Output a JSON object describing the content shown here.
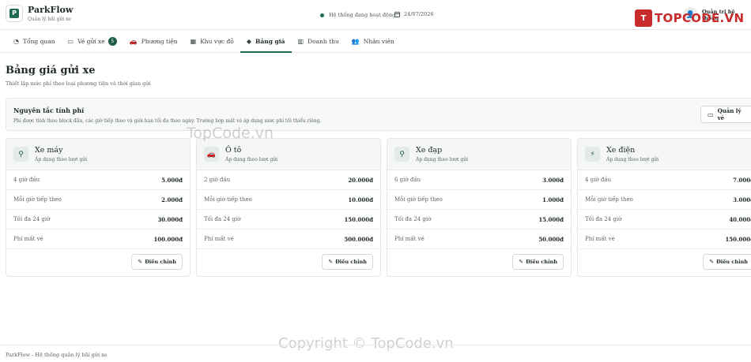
{
  "header": {
    "app_name": "ParkFlow",
    "app_tagline": "Quản lý bãi gửi xe",
    "logo_letter": "P",
    "status_text": "Hệ thống đang hoạt động",
    "date": "24/07/2026",
    "admin_label": "Quản trị hệ thống",
    "status_color": "#1f6b4f"
  },
  "watermark": {
    "logo_letter": "T",
    "logo_text": "TOPCODE.VN",
    "mid_text": "TopCode.vn",
    "bottom_text": "Copyright © TopCode.vn"
  },
  "nav": {
    "items": [
      {
        "label": "Tổng quan",
        "icon": "gauge-icon"
      },
      {
        "label": "Vé gửi xe",
        "icon": "ticket-icon",
        "badge": "5"
      },
      {
        "label": "Phương tiện",
        "icon": "car-icon"
      },
      {
        "label": "Khu vực đỗ",
        "icon": "map-icon"
      },
      {
        "label": "Bảng giá",
        "icon": "tag-icon",
        "active": true
      },
      {
        "label": "Doanh thu",
        "icon": "chart-icon"
      },
      {
        "label": "Nhân viên",
        "icon": "users-icon"
      }
    ]
  },
  "page": {
    "title": "Bảng giá gửi xe",
    "subtitle": "Thiết lập mức phí theo loại phương tiện và thời gian gửi"
  },
  "rules": {
    "title": "Nguyên tắc tính phí",
    "text": "Phí được tính theo block đầu, các giờ tiếp theo và giới hạn tối đa theo ngày. Trường hợp mất vé áp dụng mức phí tối thiểu riêng.",
    "button_label": "Quản lý vé"
  },
  "cards": [
    {
      "name": "Xe máy",
      "desc": "Áp dụng theo lượt gửi",
      "icon": "motorbike-icon",
      "rows": [
        {
          "label": "4 giờ đầu",
          "value": "5.000đ"
        },
        {
          "label": "Mỗi giờ tiếp theo",
          "value": "2.000đ"
        },
        {
          "label": "Tối đa 24 giờ",
          "value": "30.000đ"
        },
        {
          "label": "Phí mất vé",
          "value": "100.000đ"
        }
      ],
      "edit_label": "Điều chỉnh"
    },
    {
      "name": "Ô tô",
      "desc": "Áp dụng theo lượt gửi",
      "icon": "car-icon",
      "rows": [
        {
          "label": "2 giờ đầu",
          "value": "20.000đ"
        },
        {
          "label": "Mỗi giờ tiếp theo",
          "value": "10.000đ"
        },
        {
          "label": "Tối đa 24 giờ",
          "value": "150.000đ"
        },
        {
          "label": "Phí mất vé",
          "value": "500.000đ"
        }
      ],
      "edit_label": "Điều chỉnh"
    },
    {
      "name": "Xe đạp",
      "desc": "Áp dụng theo lượt gửi",
      "icon": "bicycle-icon",
      "rows": [
        {
          "label": "6 giờ đầu",
          "value": "3.000đ"
        },
        {
          "label": "Mỗi giờ tiếp theo",
          "value": "1.000đ"
        },
        {
          "label": "Tối đa 24 giờ",
          "value": "15.000đ"
        },
        {
          "label": "Phí mất vé",
          "value": "50.000đ"
        }
      ],
      "edit_label": "Điều chỉnh"
    },
    {
      "name": "Xe điện",
      "desc": "Áp dụng theo lượt gửi",
      "icon": "bolt-icon",
      "rows": [
        {
          "label": "4 giờ đầu",
          "value": "7.000đ"
        },
        {
          "label": "Mỗi giờ tiếp theo",
          "value": "3.000đ"
        },
        {
          "label": "Tối đa 24 giờ",
          "value": "40.000đ"
        },
        {
          "label": "Phí mất vé",
          "value": "150.000đ"
        }
      ],
      "edit_label": "Điều chỉnh"
    }
  ],
  "footer": {
    "text": "ParkFlow - Hệ thống quản lý bãi gửi xe"
  }
}
